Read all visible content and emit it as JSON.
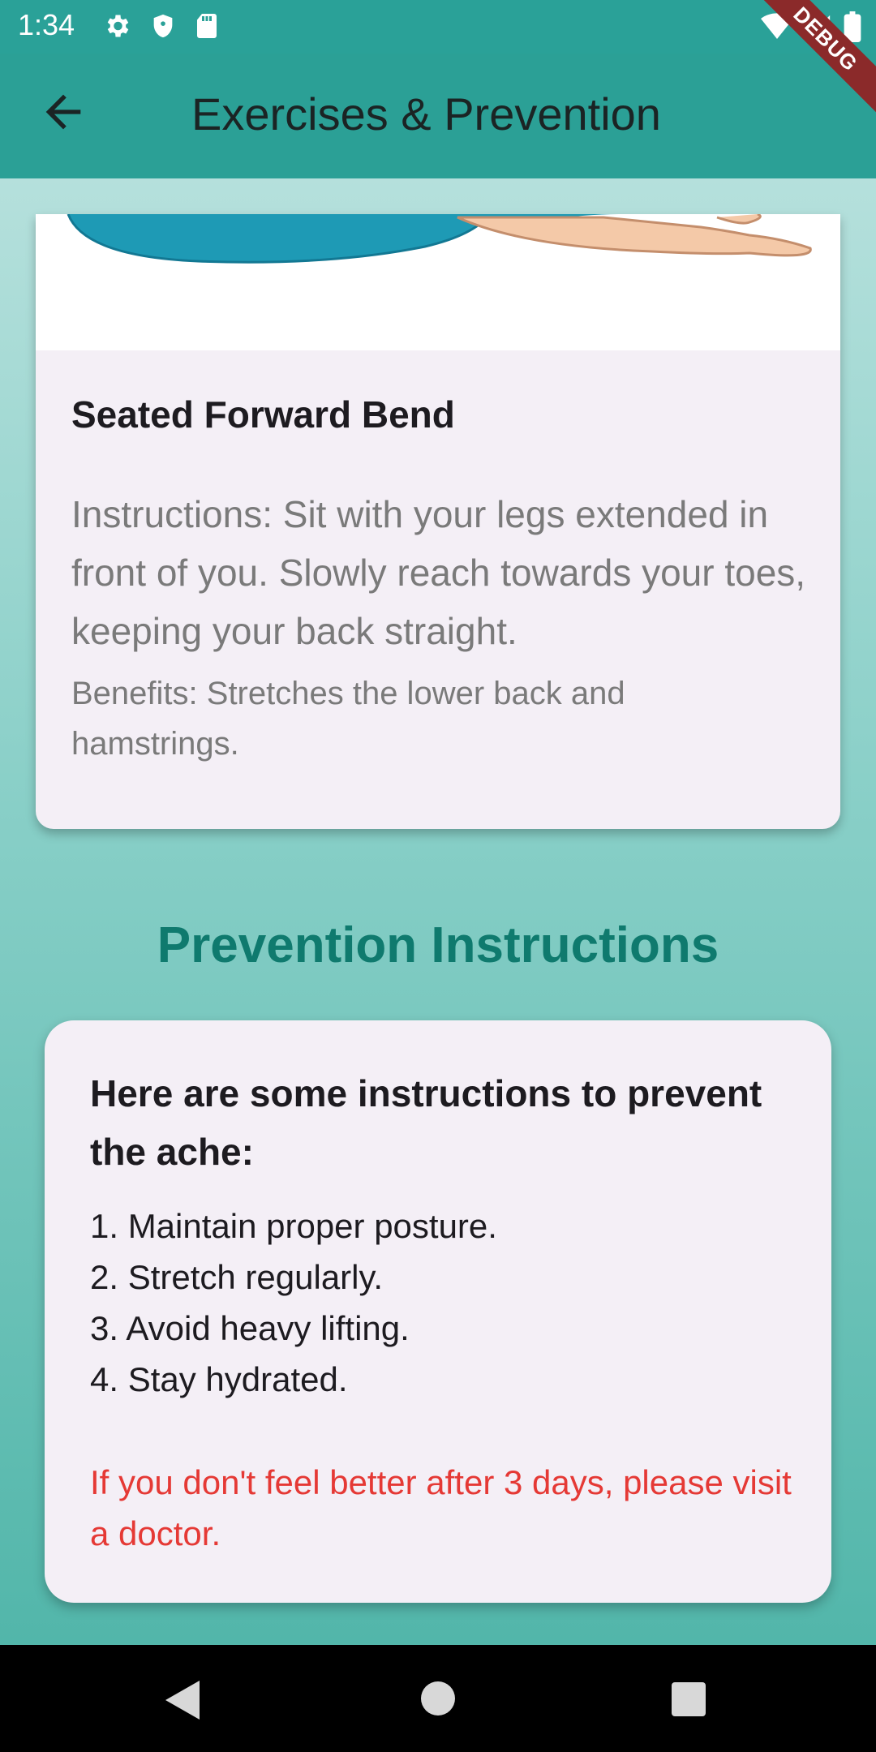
{
  "status_bar": {
    "time": "1:34",
    "icons_left": [
      "gear-icon",
      "shield-icon",
      "sd-card-icon"
    ],
    "icons_right": [
      "wifi-icon",
      "signal-icon",
      "battery-icon"
    ],
    "debug_label": "DEBUG"
  },
  "app_bar": {
    "title": "Exercises & Prevention",
    "color": "#2ba096"
  },
  "exercise": {
    "title": "Seated Forward Bend",
    "instructions": "Instructions: Sit with your legs extended in front of you. Slowly reach towards your toes, keeping your back straight.",
    "benefits": "Benefits: Stretches the lower back and hamstrings."
  },
  "prevention": {
    "section_title": "Prevention Instructions",
    "heading": "Here are some instructions to prevent the ache:",
    "items": [
      "1. Maintain proper posture.",
      "2. Stretch regularly.",
      "3. Avoid heavy lifting.",
      "4. Stay hydrated."
    ],
    "warning": "If you don't feel better after 3 days, please visit a doctor.",
    "accent_color": "#0f7a6e",
    "warning_color": "#e53935"
  },
  "nav_bar": {
    "icons": [
      "nav-back-icon",
      "nav-home-icon",
      "nav-recents-icon"
    ]
  }
}
